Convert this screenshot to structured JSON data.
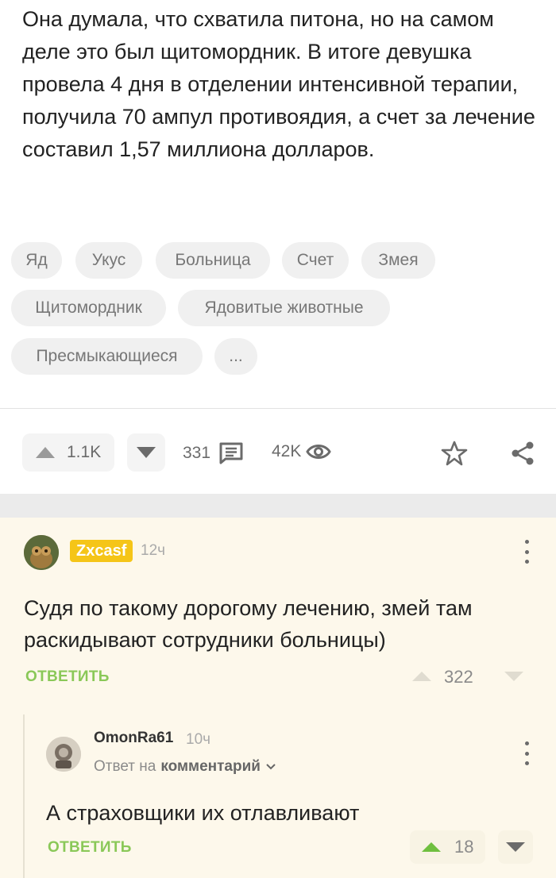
{
  "post": {
    "text": "Она думала, что схватила питона, но на самом деле это был щитомордник. В итоге девушка провела 4 дня в отделении интенсивной терапии, получила 70 ампул противоядия, а счет за лечение составил 1,57 миллиона долларов.",
    "tags": [
      "Яд",
      "Укус",
      "Больница",
      "Счет",
      "Змея",
      "Щитомордник",
      "Ядовитые животные",
      "Пресмыкающиеся",
      "..."
    ],
    "rating": "1.1K",
    "comments_count": "331",
    "views": "42K"
  },
  "comments": [
    {
      "author": "Zxcasf",
      "time": "12ч",
      "text": "Судя по такому дорогому лечению, змей там раскидывают сотрудники больницы)",
      "reply_label": "ОТВЕТИТЬ",
      "rating": "322"
    },
    {
      "author": "OmonRa61",
      "time": "10ч",
      "reply_prefix": "Ответ на",
      "reply_target": "комментарий",
      "text": "А страховщики их отлавливают",
      "reply_label": "ОТВЕТИТЬ",
      "rating": "18"
    }
  ],
  "colors": {
    "accent_green": "#8ac858",
    "badge_yellow": "#f5c518",
    "comment_bg": "#fdf8eb"
  },
  "icons": [
    "upvote-icon",
    "downvote-icon",
    "comments-icon",
    "views-icon",
    "star-icon",
    "share-icon",
    "more-icon",
    "chevron-down-icon"
  ]
}
